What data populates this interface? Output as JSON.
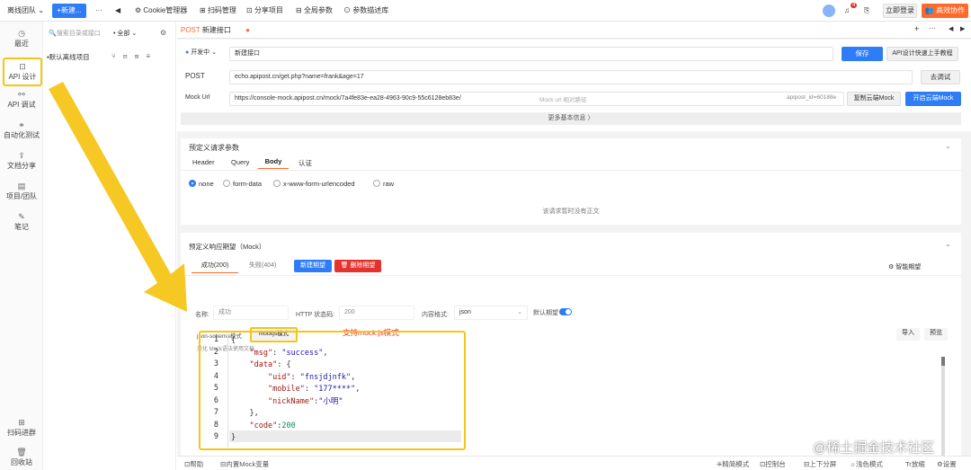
{
  "topbar": {
    "team": "离线团队",
    "new_button": "+新建...",
    "more": "···",
    "back_icon": "◀",
    "tabs": [
      "Cookie管理器",
      "扫码管理",
      "分享项目",
      "全局参数",
      "参数描述库"
    ],
    "badge_count": "4",
    "login": "立即登录",
    "collab": "高效协作"
  },
  "leftrail": {
    "items": [
      "最近",
      "API 设计",
      "API 调试",
      "自动化测试",
      "文档分享",
      "项目/团队",
      "笔记"
    ],
    "bottom": [
      "扫码进群",
      "回收站"
    ]
  },
  "projpanel": {
    "search_placeholder": "搜索目录或接口",
    "filter": "全部",
    "project": "默认离线项目"
  },
  "tab": {
    "method": "POST",
    "name": "新建接口",
    "add": "+",
    "more": "···"
  },
  "request": {
    "env": "开发中",
    "name_value": "新建接口",
    "save": "保存",
    "tutorial": "API设计快速上手教程",
    "method": "POST",
    "url": "echo.apipost.cn/get.php?name=frank&age=17",
    "debug": "去调试",
    "mock_label": "Mock Url",
    "mock_url": "https://console-mock.apipost.cn/mock/7a4fe83e-ea28-4963-90c9-55c6128eb83e/",
    "mock_placeholder": "Mock url 相对路径",
    "api_id": "apipost_id=60188e",
    "copy_mock": "复制云端Mock",
    "open_mock": "开启云端Mock",
    "more_info": "更多基本信息 〉"
  },
  "params": {
    "title": "预定义请求参数",
    "tabs": [
      "Header",
      "Query",
      "Body",
      "认证"
    ],
    "active_tab": "Body",
    "body_types": [
      "none",
      "form-data",
      "x-www-form-urlencoded",
      "raw"
    ],
    "empty": "该请求暂时没有正文"
  },
  "mock": {
    "title": "预定义响应期望（Mock）",
    "tabs": [
      "成功(200)",
      "失败(404)"
    ],
    "new_expect": "新建期望",
    "delete_expect": "删除期望",
    "smart_expect": "智能期望",
    "name_label": "名称:",
    "name_value": "成功",
    "status_label": "HTTP 状态码:",
    "status_value": "200",
    "content_label": "内容格式:",
    "content_value": "json",
    "default_label": "默认期望",
    "mode_schema": "json-schema模式",
    "mode_mockjs": "mockjs模式",
    "annotation": "支持mock.js模式",
    "import": "导入",
    "preview": "预览",
    "hint": "美化  Mock语法使用文档",
    "code_lines": [
      "{",
      "    \"msg\": \"success\",",
      "    \"data\": {",
      "        \"uid\": \"fnsjdjnfk\",",
      "        \"mobile\": \"177****\",",
      "        \"nickName\":\"小明\"",
      "    },",
      "    \"code\":200",
      "}"
    ]
  },
  "bottombar": {
    "left": [
      "帮助",
      "内置Mock变量"
    ],
    "right": [
      "精简模式",
      "控制台",
      "上下分屏",
      "浅色模式",
      "放缩",
      "设置"
    ]
  },
  "watermark": "@稀土掘金技术社区",
  "colors": {
    "accent": "#2f7df6",
    "highlight": "#f5c518",
    "danger": "#e5322d",
    "orange": "#ff6a2b"
  }
}
